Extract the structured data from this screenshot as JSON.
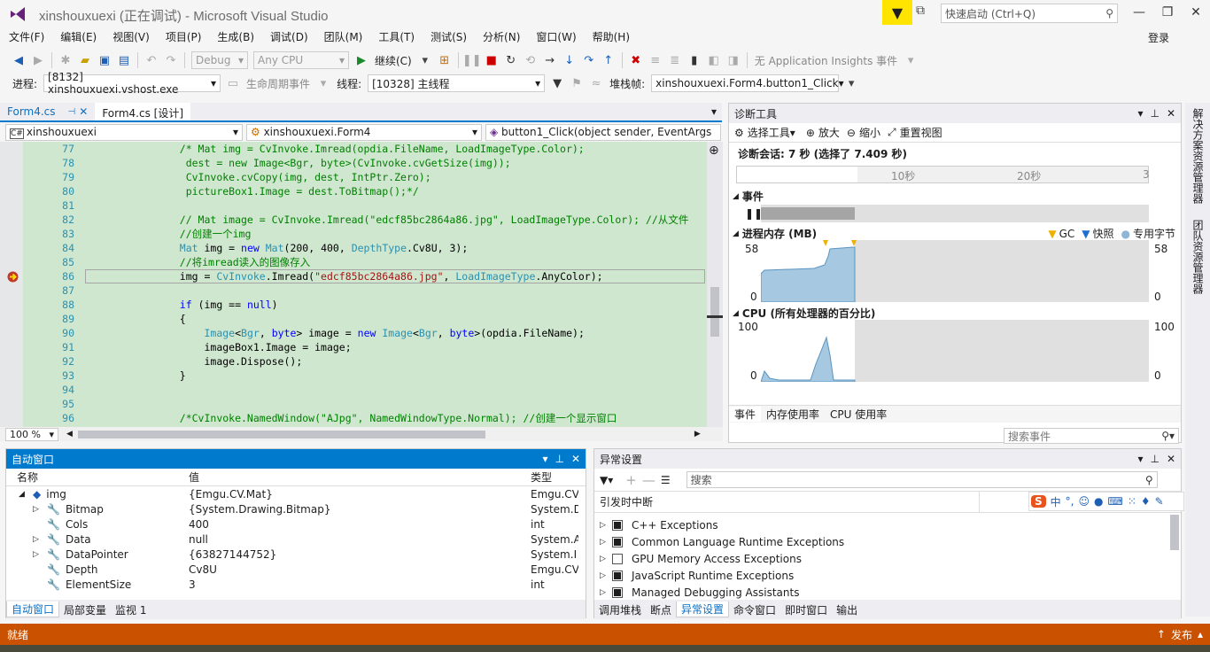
{
  "window": {
    "title": "xinshouxuexi (正在调试) - Microsoft Visual Studio",
    "quick_launch_placeholder": "快速启动 (Ctrl+Q)",
    "login": "登录"
  },
  "menu": [
    "文件(F)",
    "编辑(E)",
    "视图(V)",
    "项目(P)",
    "生成(B)",
    "调试(D)",
    "团队(M)",
    "工具(T)",
    "测试(S)",
    "分析(N)",
    "窗口(W)",
    "帮助(H)"
  ],
  "toolbar1": {
    "config": "Debug",
    "platform": "Any CPU",
    "continue_label": "继续(C)",
    "insights": "无 Application Insights 事件"
  },
  "toolbar2": {
    "process_label": "进程:",
    "process_value": "[8132] xinshouxuexi.vshost.exe",
    "lifecycle_label": "生命周期事件",
    "thread_label": "线程:",
    "thread_value": "[10328] 主线程",
    "stack_label": "堆栈帧:",
    "stack_value": "xinshouxuexi.Form4.button1_Click"
  },
  "doc_tabs": [
    "Form4.cs",
    "Form4.cs [设计]"
  ],
  "navbar": {
    "project": "xinshouxuexi",
    "class": "xinshouxuexi.Form4",
    "member": "button1_Click(object sender, EventArgs"
  },
  "editor": {
    "zoom": "100 %",
    "line_numbers": [
      "77",
      "78",
      "79",
      "80",
      "81",
      "82",
      "83",
      "84",
      "85",
      "86",
      "87",
      "88",
      "89",
      "90",
      "91",
      "92",
      "93",
      "94",
      "95",
      "96"
    ],
    "lines": [
      [
        {
          "t": "                /* Mat img = CvInvoke.Imread(opdia.FileName, LoadImageType.Color);",
          "c": "com"
        }
      ],
      [
        {
          "t": "                 dest = new Image<Bgr, byte>(CvInvoke.cvGetSize(img));",
          "c": "com"
        }
      ],
      [
        {
          "t": "                 CvInvoke.cvCopy(img, dest, IntPtr.Zero);",
          "c": "com"
        }
      ],
      [
        {
          "t": "                 pictureBox1.Image = dest.ToBitmap();*/",
          "c": "com"
        }
      ],
      [
        {
          "t": "",
          "c": "tx"
        }
      ],
      [
        {
          "t": "                // Mat image = CvInvoke.Imread(\"edcf85bc2864a86.jpg\", LoadImageType.Color); //从文件",
          "c": "com"
        }
      ],
      [
        {
          "t": "                //创建一个img",
          "c": "com"
        }
      ],
      [
        {
          "t": "                ",
          "c": "tx"
        },
        {
          "t": "Mat",
          "c": "ty"
        },
        {
          "t": " img = ",
          "c": "tx"
        },
        {
          "t": "new",
          "c": "kw"
        },
        {
          "t": " ",
          "c": "tx"
        },
        {
          "t": "Mat",
          "c": "ty"
        },
        {
          "t": "(200, 400, ",
          "c": "tx"
        },
        {
          "t": "DepthType",
          "c": "ty"
        },
        {
          "t": ".Cv8U, 3);",
          "c": "tx"
        }
      ],
      [
        {
          "t": "                //将imread读入的图像存入",
          "c": "com"
        }
      ],
      [
        {
          "t": "                img = ",
          "c": "tx"
        },
        {
          "t": "CvInvoke",
          "c": "ty"
        },
        {
          "t": ".Imread(",
          "c": "tx"
        },
        {
          "t": "\"edcf85bc2864a86.jpg\"",
          "c": "str"
        },
        {
          "t": ", ",
          "c": "tx"
        },
        {
          "t": "LoadImageType",
          "c": "ty"
        },
        {
          "t": ".AnyColor);",
          "c": "tx"
        }
      ],
      [
        {
          "t": "",
          "c": "tx"
        }
      ],
      [
        {
          "t": "                ",
          "c": "tx"
        },
        {
          "t": "if",
          "c": "kw"
        },
        {
          "t": " (img == ",
          "c": "tx"
        },
        {
          "t": "null",
          "c": "kw"
        },
        {
          "t": ")",
          "c": "tx"
        }
      ],
      [
        {
          "t": "                {",
          "c": "tx"
        }
      ],
      [
        {
          "t": "                    ",
          "c": "tx"
        },
        {
          "t": "Image",
          "c": "ty"
        },
        {
          "t": "<",
          "c": "tx"
        },
        {
          "t": "Bgr",
          "c": "ty"
        },
        {
          "t": ", ",
          "c": "tx"
        },
        {
          "t": "byte",
          "c": "kw"
        },
        {
          "t": "> image = ",
          "c": "tx"
        },
        {
          "t": "new",
          "c": "kw"
        },
        {
          "t": " ",
          "c": "tx"
        },
        {
          "t": "Image",
          "c": "ty"
        },
        {
          "t": "<",
          "c": "tx"
        },
        {
          "t": "Bgr",
          "c": "ty"
        },
        {
          "t": ", ",
          "c": "tx"
        },
        {
          "t": "byte",
          "c": "kw"
        },
        {
          "t": ">(opdia.FileName);",
          "c": "tx"
        }
      ],
      [
        {
          "t": "                    imageBox1.Image = image;",
          "c": "tx"
        }
      ],
      [
        {
          "t": "                    image.Dispose();",
          "c": "tx"
        }
      ],
      [
        {
          "t": "                }",
          "c": "tx"
        }
      ],
      [
        {
          "t": "",
          "c": "tx"
        }
      ],
      [
        {
          "t": "",
          "c": "tx"
        }
      ],
      [
        {
          "t": "                /*CvInvoke.NamedWindow(\"AJpg\", NamedWindowType.Normal); //创建一个显示窗口",
          "c": "com"
        }
      ]
    ]
  },
  "diag": {
    "title": "诊断工具",
    "select_tool": "选择工具",
    "zoom_in": "放大",
    "zoom_out": "缩小",
    "reset_view": "重置视图",
    "session": "诊断会话: 7 秒 (选择了 7.409 秒)",
    "ticks": [
      "10秒",
      "20秒",
      "3"
    ],
    "events_label": "事件",
    "memory_label": "进程内存 (MB)",
    "legend": [
      "GC",
      "快照",
      "专用字节"
    ],
    "mem_max": "58",
    "mem_min": "0",
    "cpu_label": "CPU (所有处理器的百分比)",
    "cpu_max": "100",
    "cpu_min": "0",
    "tabs": [
      "事件",
      "内存使用率",
      "CPU 使用率"
    ],
    "search_placeholder": "搜索事件"
  },
  "right_sidebar": [
    "解决方案资源管理器",
    "团队资源管理器"
  ],
  "autos": {
    "title": "自动窗口",
    "headers": [
      "名称",
      "值",
      "类型"
    ],
    "rows": [
      {
        "name": "img",
        "value": "{Emgu.CV.Mat}",
        "type": "Emgu.CV"
      },
      {
        "name": "Bitmap",
        "value": "{System.Drawing.Bitmap}",
        "type": "System.D"
      },
      {
        "name": "Cols",
        "value": "400",
        "type": "int"
      },
      {
        "name": "Data",
        "value": "null",
        "type": "System.A"
      },
      {
        "name": "DataPointer",
        "value": "{63827144752}",
        "type": "System.I"
      },
      {
        "name": "Depth",
        "value": "Cv8U",
        "type": "Emgu.CV"
      },
      {
        "name": "ElementSize",
        "value": "3",
        "type": "int"
      }
    ],
    "tabs": [
      "自动窗口",
      "局部变量",
      "监视 1"
    ]
  },
  "exceptions": {
    "title": "异常设置",
    "search_placeholder": "搜索",
    "header": "引发时中断",
    "items": [
      "C++ Exceptions",
      "Common Language Runtime Exceptions",
      "GPU Memory Access Exceptions",
      "JavaScript Runtime Exceptions",
      "Managed Debugging Assistants"
    ],
    "checked": [
      true,
      true,
      false,
      true,
      true
    ],
    "tabs": [
      "调用堆栈",
      "断点",
      "异常设置",
      "命令窗口",
      "即时窗口",
      "输出"
    ]
  },
  "status": {
    "left": "就绪",
    "right": "发布"
  },
  "colors": {
    "accent": "#007acc",
    "status": "#ca5100",
    "code_bg": "#cfe6cf",
    "memory_fill": "#a6c8e0"
  }
}
